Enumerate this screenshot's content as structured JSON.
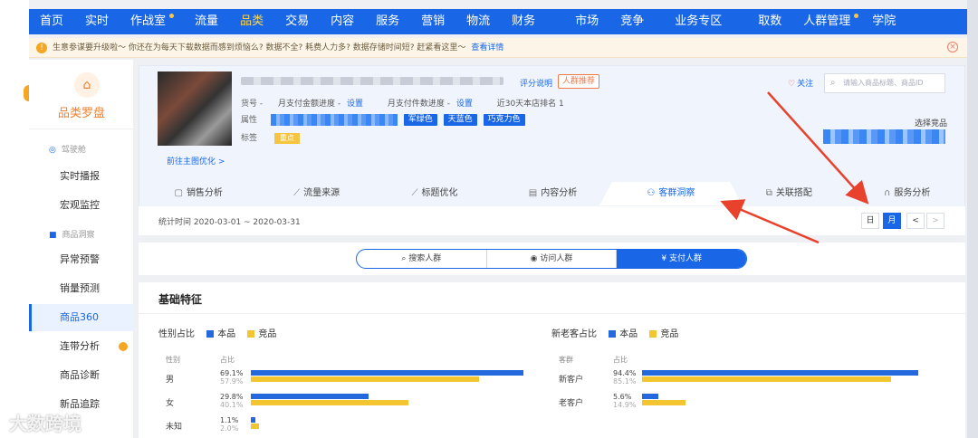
{
  "nav": [
    "首页",
    "实时",
    "作战室",
    "流量",
    "品类",
    "交易",
    "内容",
    "服务",
    "营销",
    "物流",
    "财务",
    "市场",
    "竞争",
    "业务专区",
    "取数",
    "人群管理",
    "学院"
  ],
  "notice": {
    "text": "生意参谋要升级啦～ 你还在为每天下载数据而感到烦恼么? 数据不全? 耗费人力多? 数据存储时间短? 赶紧看这里～",
    "link": "查看详情"
  },
  "sidebar": {
    "title": "品类罗盘",
    "group1": "驾驶舱",
    "group2": "商品洞察",
    "items": [
      "实时播报",
      "宏观监控",
      "异常预警",
      "销量预测",
      "商品360",
      "连带分析",
      "商品诊断",
      "新品追踪"
    ]
  },
  "product": {
    "score_link": "评分说明",
    "crowd_btn": "人群推荐",
    "item_no_label": "货号 -",
    "pay_amount_label": "月支付金额进度 -",
    "pay_count_label": "月支付件数进度 -",
    "set_label": "设置",
    "rank": "近30天本店排名 1",
    "attr_label": "属性",
    "attrs": [
      "军绿色",
      "天蓝色",
      "巧克力色"
    ],
    "tag_label": "标签",
    "tag": "重点",
    "optimize_link": "前往主图优化 >",
    "follow": "关注",
    "search_placeholder": "请输入商品标题、商品ID",
    "choose": "选择竞品"
  },
  "tabs": [
    "销售分析",
    "流量来源",
    "标题优化",
    "内容分析",
    "客群洞察",
    "关联搭配",
    "服务分析"
  ],
  "date": {
    "text": "统计时间 2020-03-01 ~ 2020-03-31",
    "day": "日",
    "month": "月",
    "prev": "<",
    "next": ">"
  },
  "segments": [
    "搜索人群",
    "访问人群",
    "支付人群"
  ],
  "base": {
    "title": "基础特征",
    "legend_own": "本品",
    "legend_comp": "竞品",
    "col_pct": "占比",
    "gender": {
      "title": "性别占比",
      "col": "性别",
      "rows": [
        {
          "label": "男",
          "own": 69.1,
          "comp": 57.9,
          "own_text": "69.1%",
          "comp_text": "57.9%"
        },
        {
          "label": "女",
          "own": 29.8,
          "comp": 40.1,
          "own_text": "29.8%",
          "comp_text": "40.1%"
        },
        {
          "label": "未知",
          "own": 1.1,
          "comp": 2.0,
          "own_text": "1.1%",
          "comp_text": "2.0%"
        }
      ]
    },
    "customer": {
      "title": "新老客占比",
      "col": "客群",
      "rows": [
        {
          "label": "新客户",
          "own": 94.4,
          "comp": 85.1,
          "own_text": "94.4%",
          "comp_text": "85.1%"
        },
        {
          "label": "老客户",
          "own": 5.6,
          "comp": 14.9,
          "own_text": "5.6%",
          "comp_text": "14.9%"
        }
      ]
    }
  },
  "colors": {
    "primary": "#1967e6",
    "own_bar": "#2468de",
    "comp_bar": "#f2c531",
    "arrow": "#e8412c"
  },
  "watermark": "大数跨境"
}
